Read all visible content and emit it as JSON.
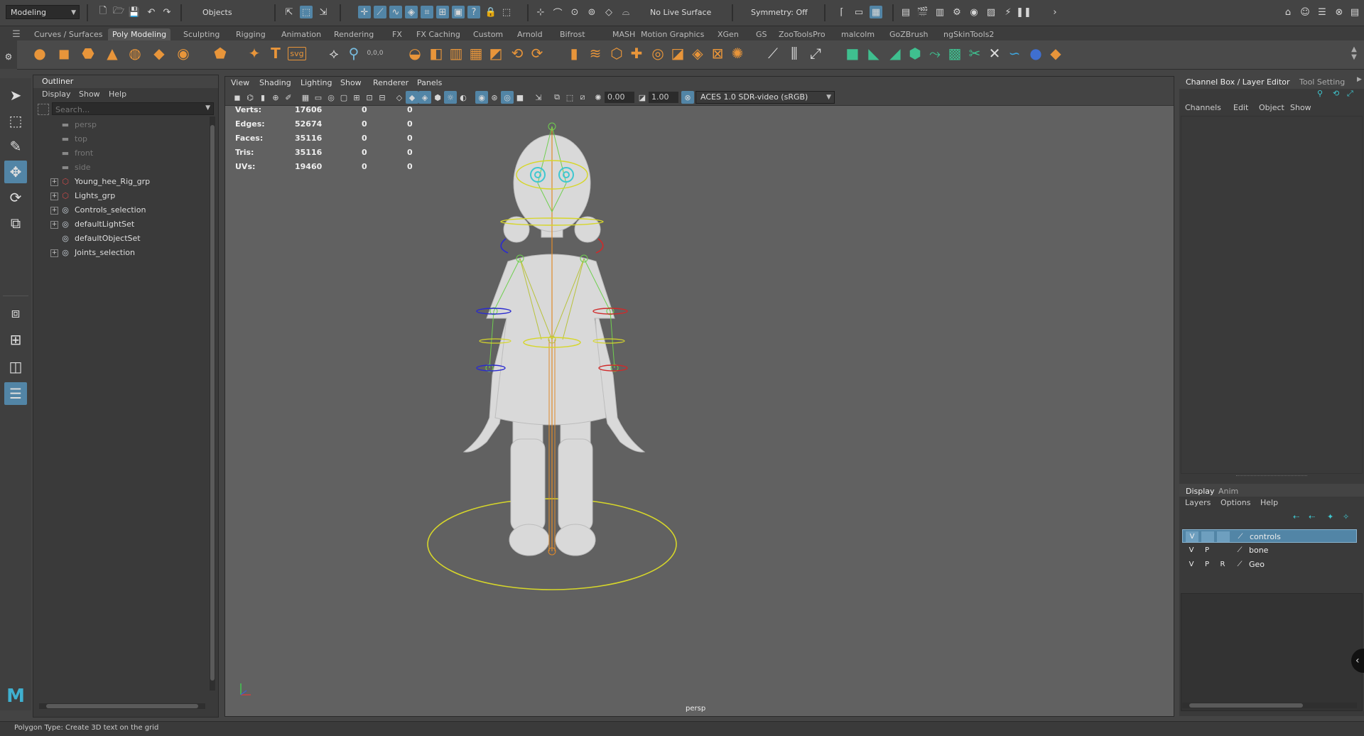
{
  "statusline": {
    "menuset": "Modeling",
    "select_mode": "Objects",
    "live_surface": "No Live Surface",
    "symmetry": "Symmetry: Off"
  },
  "shelf": {
    "tabs": [
      "Curves / Surfaces",
      "Poly Modeling",
      "Sculpting",
      "Rigging",
      "Animation",
      "Rendering",
      "FX",
      "FX Caching",
      "Custom",
      "Arnold",
      "Bifrost",
      "MASH",
      "Motion Graphics",
      "XGen",
      "GS",
      "ZooToolsPro",
      "malcolm",
      "GoZBrush",
      "ngSkinTools2"
    ],
    "active": "Poly Modeling",
    "text_tool_glyph": "T",
    "svg_tool_glyph": "svg",
    "coords_glyph": "0,0,0"
  },
  "outliner": {
    "title": "Outliner",
    "menu": [
      "Display",
      "Show",
      "Help"
    ],
    "search_placeholder": "Search...",
    "items": [
      {
        "label": "persp",
        "dim": true,
        "expandable": false
      },
      {
        "label": "top",
        "dim": true,
        "expandable": false
      },
      {
        "label": "front",
        "dim": true,
        "expandable": false
      },
      {
        "label": "side",
        "dim": true,
        "expandable": false
      },
      {
        "label": "Young_hee_Rig_grp",
        "dim": false,
        "expandable": true
      },
      {
        "label": "Lights_grp",
        "dim": false,
        "expandable": true
      },
      {
        "label": "Controls_selection",
        "dim": false,
        "expandable": true
      },
      {
        "label": "defaultLightSet",
        "dim": false,
        "expandable": true
      },
      {
        "label": "defaultObjectSet",
        "dim": false,
        "expandable": false
      },
      {
        "label": "Joints_selection",
        "dim": false,
        "expandable": true
      }
    ]
  },
  "viewport": {
    "menu": [
      "View",
      "Shading",
      "Lighting",
      "Show",
      "Renderer",
      "Panels"
    ],
    "exposure": "0.00",
    "gamma": "1.00",
    "color_space": "ACES 1.0 SDR-video (sRGB)",
    "camera_label": "persp",
    "hud": [
      {
        "label": "Verts:",
        "v1": "17606",
        "v2": "0",
        "v3": "0"
      },
      {
        "label": "Edges:",
        "v1": "52674",
        "v2": "0",
        "v3": "0"
      },
      {
        "label": "Faces:",
        "v1": "35116",
        "v2": "0",
        "v3": "0"
      },
      {
        "label": "Tris:",
        "v1": "35116",
        "v2": "0",
        "v3": "0"
      },
      {
        "label": "UVs:",
        "v1": "19460",
        "v2": "0",
        "v3": "0"
      }
    ]
  },
  "channelbox": {
    "tab_channel": "Channel Box / Layer Editor",
    "tab_tool": "Tool Setting",
    "menu": [
      "Channels",
      "Edit",
      "Object",
      "Show"
    ]
  },
  "layers": {
    "tabs": [
      "Display",
      "Anim"
    ],
    "menu": [
      "Layers",
      "Options",
      "Help"
    ],
    "rows": [
      {
        "v": "V",
        "p": "",
        "r": "",
        "name": "controls",
        "selected": true
      },
      {
        "v": "V",
        "p": "P",
        "r": "",
        "name": "bone",
        "selected": false
      },
      {
        "v": "V",
        "p": "P",
        "r": "R",
        "name": "Geo",
        "selected": false
      }
    ]
  },
  "helpline": "Polygon Type: Create 3D text on the grid",
  "colors": {
    "accent": "#5285a6",
    "shelf_orange": "#e8953a",
    "shelf_teal": "#3fbf8f",
    "ground_ring": "#d6d62a"
  }
}
